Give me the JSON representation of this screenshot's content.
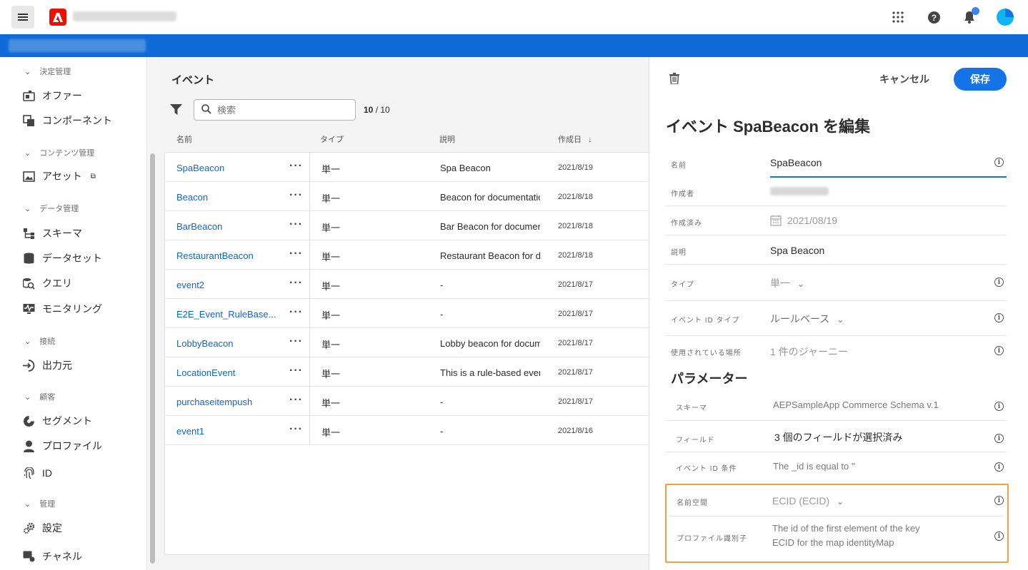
{
  "header": {
    "menu_icon": "hamburger-icon",
    "logo_icon": "adobe-logo-icon",
    "icons": [
      "apps-grid-icon",
      "help-icon",
      "bell-icon",
      "avatar"
    ]
  },
  "sidebar": {
    "sections": [
      {
        "title": "決定管理",
        "items": [
          {
            "label": "オファー",
            "icon": "offer-icon"
          },
          {
            "label": "コンポーネント",
            "icon": "components-icon"
          }
        ]
      },
      {
        "title": "コンテンツ管理",
        "items": [
          {
            "label": "アセット",
            "icon": "assets-icon"
          }
        ]
      },
      {
        "title": "データ管理",
        "items": [
          {
            "label": "スキーマ",
            "icon": "schema-icon"
          },
          {
            "label": "データセット",
            "icon": "dataset-icon"
          },
          {
            "label": "クエリ",
            "icon": "query-icon"
          },
          {
            "label": "モニタリング",
            "icon": "monitoring-icon"
          }
        ]
      },
      {
        "title": "接続",
        "items": [
          {
            "label": "出力元",
            "icon": "sources-icon"
          }
        ]
      },
      {
        "title": "顧客",
        "items": [
          {
            "label": "セグメント",
            "icon": "segment-icon"
          },
          {
            "label": "プロファイル",
            "icon": "profile-icon"
          },
          {
            "label": "ID",
            "icon": "fingerprint-icon"
          }
        ]
      },
      {
        "title": "管理",
        "items": [
          {
            "label": "設定",
            "icon": "settings-icon"
          },
          {
            "label": "チャネル",
            "icon": "channel-icon"
          }
        ]
      }
    ]
  },
  "list": {
    "title": "イベント",
    "search_placeholder": "検索",
    "count_shown": "10",
    "count_total": "10",
    "columns": {
      "name": "名前",
      "type": "タイプ",
      "description": "説明",
      "created": "作成日"
    },
    "rows": [
      {
        "name": "SpaBeacon",
        "type": "単一",
        "description": "Spa Beacon",
        "date": "2021/8/19"
      },
      {
        "name": "Beacon",
        "type": "単一",
        "description": "Beacon for documentatio",
        "date": "2021/8/18"
      },
      {
        "name": "BarBeacon",
        "type": "単一",
        "description": "Bar Beacon for documen",
        "date": "2021/8/18"
      },
      {
        "name": "RestaurantBeacon",
        "type": "単一",
        "description": "Restaurant Beacon for do",
        "date": "2021/8/18"
      },
      {
        "name": "event2",
        "type": "単一",
        "description": "-",
        "date": "2021/8/17"
      },
      {
        "name": "E2E_Event_RuleBase...",
        "type": "単一",
        "description": "-",
        "date": "2021/8/17"
      },
      {
        "name": "LobbyBeacon",
        "type": "単一",
        "description": "Lobby beacon for docum",
        "date": "2021/8/17"
      },
      {
        "name": "LocationEvent",
        "type": "単一",
        "description": "This is a rule-based even",
        "date": "2021/8/17"
      },
      {
        "name": "purchaseitempush",
        "type": "単一",
        "description": "-",
        "date": "2021/8/17"
      },
      {
        "name": "event1",
        "type": "単一",
        "description": "-",
        "date": "2021/8/16"
      }
    ]
  },
  "panel": {
    "cancel_label": "キャンセル",
    "save_label": "保存",
    "title": "イベント SpaBeacon を編集",
    "fields": {
      "name_label": "名前",
      "name_value": "SpaBeacon",
      "author_label": "作成者",
      "created_label": "作成済み",
      "created_value": "2021/08/19",
      "description_label": "説明",
      "description_value": "Spa Beacon",
      "type_label": "タイプ",
      "type_value": "単一",
      "event_id_type_label": "イベント ID タイプ",
      "event_id_type_value": "ルールベース",
      "used_in_label": "使用されている場所",
      "used_in_value": "1 件のジャーニー"
    },
    "parameters_title": "パラメーター",
    "params": {
      "schema_label": "スキーマ",
      "schema_value": "AEPSampleApp Commerce Schema v.1",
      "fields_label": "フィールド",
      "fields_value": "3 個のフィールドが選択済み",
      "condition_label": "イベント ID 条件",
      "condition_value": "The _id is equal to ''",
      "namespace_label": "名前空間",
      "namespace_value": "ECID (ECID)",
      "profile_id_label": "プロファイル識別子",
      "profile_id_line1": "The id of the first element of the key",
      "profile_id_line2": "ECID for the map identityMap"
    }
  },
  "colors": {
    "accent": "#1473e6",
    "brand_bar": "#0f6ad7",
    "highlight": "#f1a140",
    "link": "#1465c8"
  }
}
